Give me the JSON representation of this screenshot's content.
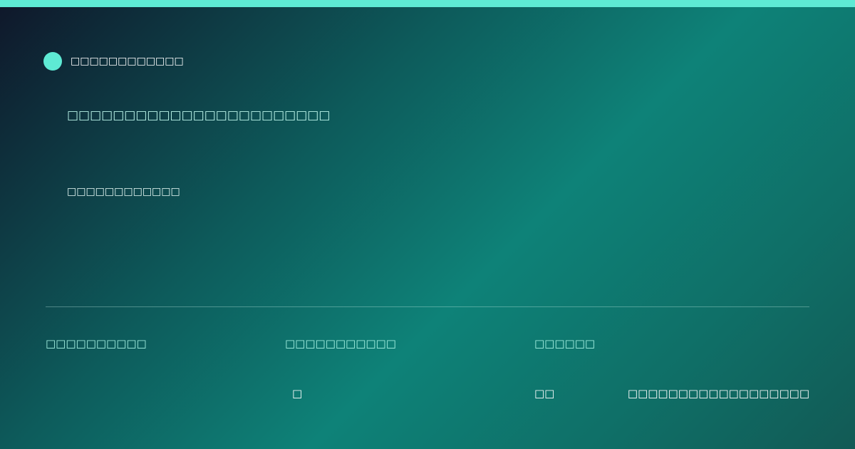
{
  "brand": {
    "name": "□□□□□□□□□□□□",
    "accent_color": "#5eead4"
  },
  "hero": {
    "headline": "□□□□□□□□□□□□□□□□□□□□□□□",
    "subtitle": "□□□□□□□□□□□□"
  },
  "stats": [
    {
      "label": "□□□□□□□□□□",
      "value": ""
    },
    {
      "label": "□□□□□□□□□□□",
      "value": "□"
    },
    {
      "label": "□□□□□□",
      "value": "□□"
    }
  ],
  "footer": {
    "text": "□□□□□□□□□□□□□□□□□□"
  },
  "colors": {
    "accent": "#5eead4",
    "gradient_start": "#0f172a",
    "gradient_mid": "#0e8278",
    "gradient_end": "#125a55"
  }
}
